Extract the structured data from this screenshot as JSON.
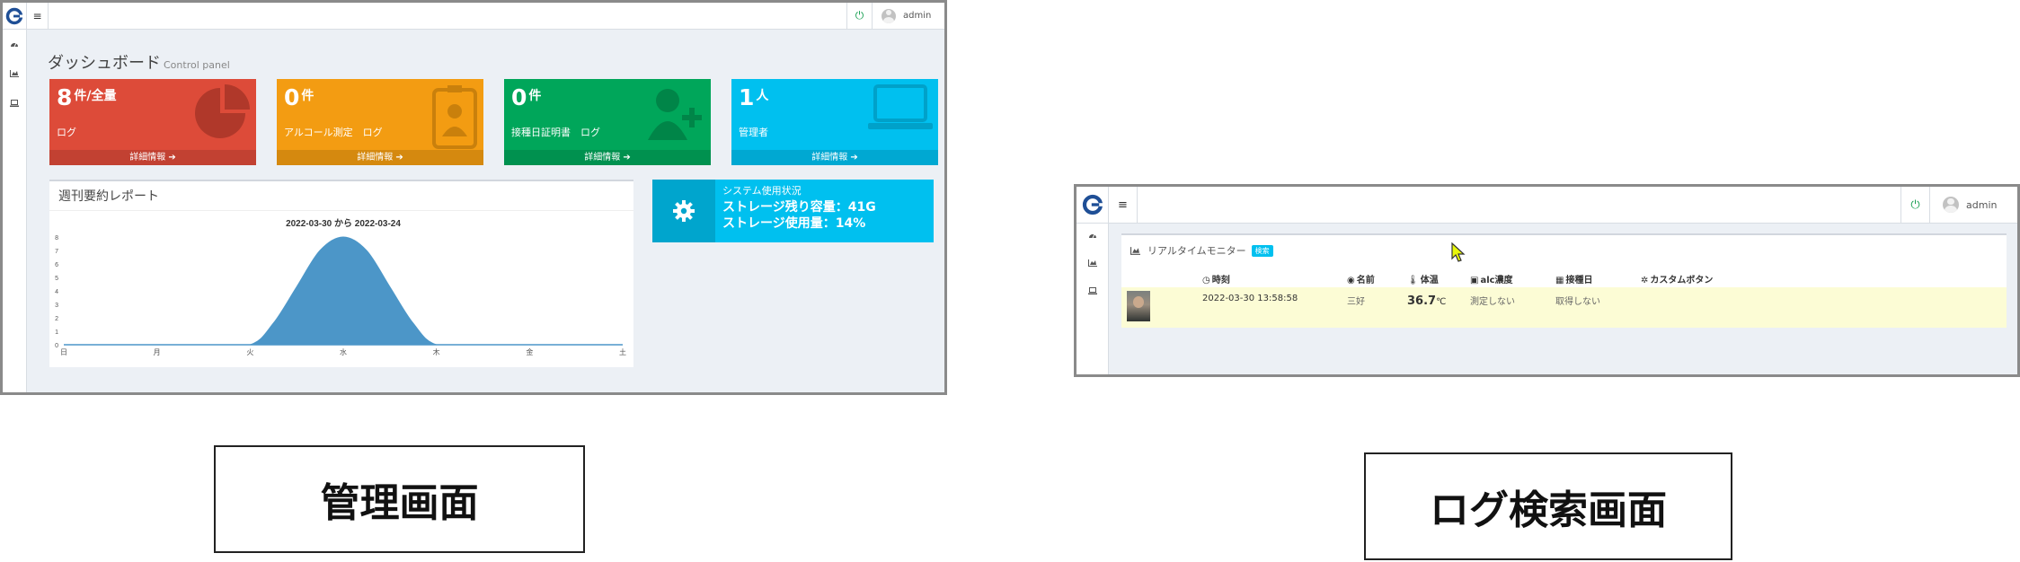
{
  "dashboard": {
    "user": "admin",
    "page_title": "ダッシュボード",
    "page_subtitle": "Control panel",
    "boxes": [
      {
        "value": "8",
        "unit": "件/全量",
        "label": "ログ",
        "footer": "詳細情報",
        "color": "#dd4b39",
        "icon": "pie-chart-icon"
      },
      {
        "value": "0",
        "unit": "件",
        "label": "アルコール測定　ログ",
        "footer": "詳細情報",
        "color": "#f39c12",
        "icon": "id-badge-icon"
      },
      {
        "value": "0",
        "unit": "件",
        "label": "接種日証明書　ログ",
        "footer": "詳細情報",
        "color": "#00a65a",
        "icon": "user-plus-icon"
      },
      {
        "value": "1",
        "unit": "人",
        "label": "管理者",
        "footer": "詳細情報",
        "color": "#00c0ef",
        "icon": "laptop-icon"
      }
    ],
    "report": {
      "title": "週刊要約レポート",
      "chart_data": {
        "type": "area",
        "title": "2022-03-30 から 2022-03-24",
        "categories": [
          "日",
          "月",
          "火",
          "水",
          "木",
          "金",
          "土"
        ],
        "x": [
          0,
          0.5,
          1,
          1.5,
          2,
          2.25,
          2.5,
          2.75,
          3,
          3.25,
          3.5,
          3.75,
          4,
          4.5,
          5,
          5.5,
          6
        ],
        "series": [
          {
            "values": [
              0,
              0,
              0,
              0,
              0,
              1.6,
              4.3,
              7.0,
              8.0,
              7.0,
              4.3,
              1.6,
              0,
              0,
              0,
              0,
              0
            ],
            "color": "#4c96c8"
          }
        ],
        "yticks": [
          0,
          1,
          2,
          3,
          4,
          5,
          6,
          7,
          8
        ],
        "ylim": [
          0,
          8
        ],
        "grid": false,
        "legend": "none"
      }
    },
    "system": {
      "title": "システム使用状況",
      "line1": "ストレージ残り容量：41G",
      "line2": "ストレージ使用量：14%",
      "icon": "gear-icon"
    }
  },
  "logsearch": {
    "user": "admin",
    "panel_title": "リアルタイムモニター",
    "badge": "検索",
    "columns": [
      {
        "icon": "clock-icon",
        "glyph": "◷",
        "label": "時刻"
      },
      {
        "icon": "user-circle-icon",
        "glyph": "◉",
        "label": "名前"
      },
      {
        "icon": "thermometer-icon",
        "glyph": "🌡",
        "label": "体温"
      },
      {
        "icon": "alc-icon",
        "glyph": "▣",
        "label": "alc濃度"
      },
      {
        "icon": "calendar-icon",
        "glyph": "▦",
        "label": "接種日"
      },
      {
        "icon": "gear-icon",
        "glyph": "✲",
        "label": "カスタムボタン"
      }
    ],
    "rows": [
      {
        "time": "2022-03-30 13:58:58",
        "name": "三好",
        "temp": "36.7",
        "temp_unit": "℃",
        "alc": "測定しない",
        "vaccine": "取得しない"
      }
    ]
  },
  "captions": {
    "left": "管理画面",
    "right": "ログ検索画面"
  },
  "colors": {
    "accent": "#00c0ef",
    "logo": "#1f4f96",
    "power": "#1aa053",
    "row_highlight": "#fcfcd5"
  }
}
